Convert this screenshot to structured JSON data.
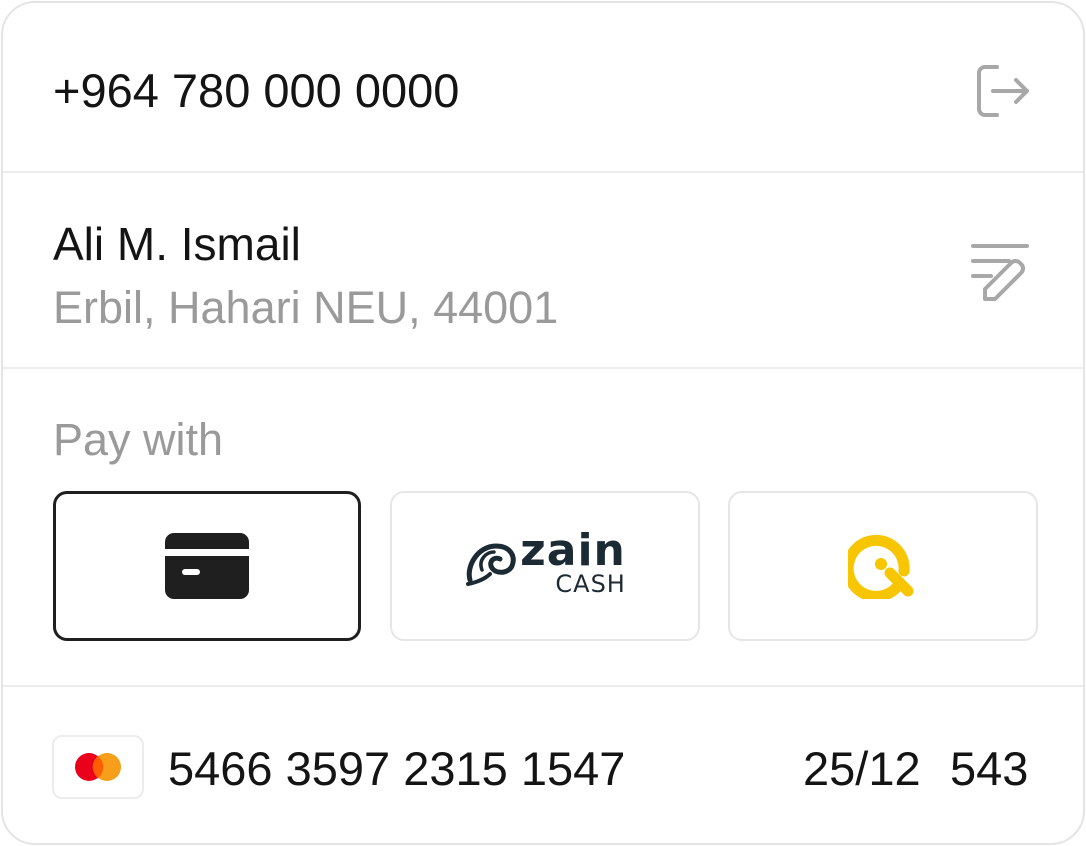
{
  "account": {
    "phone": "+964 780 000 0000",
    "logout_icon": "logout-icon"
  },
  "shipping": {
    "name": "Ali M. Ismail",
    "address": "Erbil, Hahari NEU, 44001",
    "edit_icon": "edit-list-icon"
  },
  "payment": {
    "label": "Pay with",
    "selected": "card",
    "options": [
      {
        "id": "card",
        "icon": "credit-card-icon"
      },
      {
        "id": "zain-cash",
        "brand_word": "zain",
        "brand_sub": "CASH",
        "icon": "zain-swirl-icon",
        "color": "#1c2a33"
      },
      {
        "id": "qi",
        "icon": "qi-logo-icon",
        "color": "#f7c600"
      }
    ]
  },
  "card": {
    "brand_icon": "mastercard-icon",
    "number": "5466 3597 2315 1547",
    "expiry": "25/12",
    "cvv": "543"
  },
  "colors": {
    "text": "#141414",
    "muted": "#9a9a9a",
    "border": "#e6e6e6",
    "selected_border": "#1f1f1f",
    "mastercard_red": "#eb001b",
    "mastercard_orange": "#f79e1b",
    "qi_yellow": "#f7c600"
  }
}
